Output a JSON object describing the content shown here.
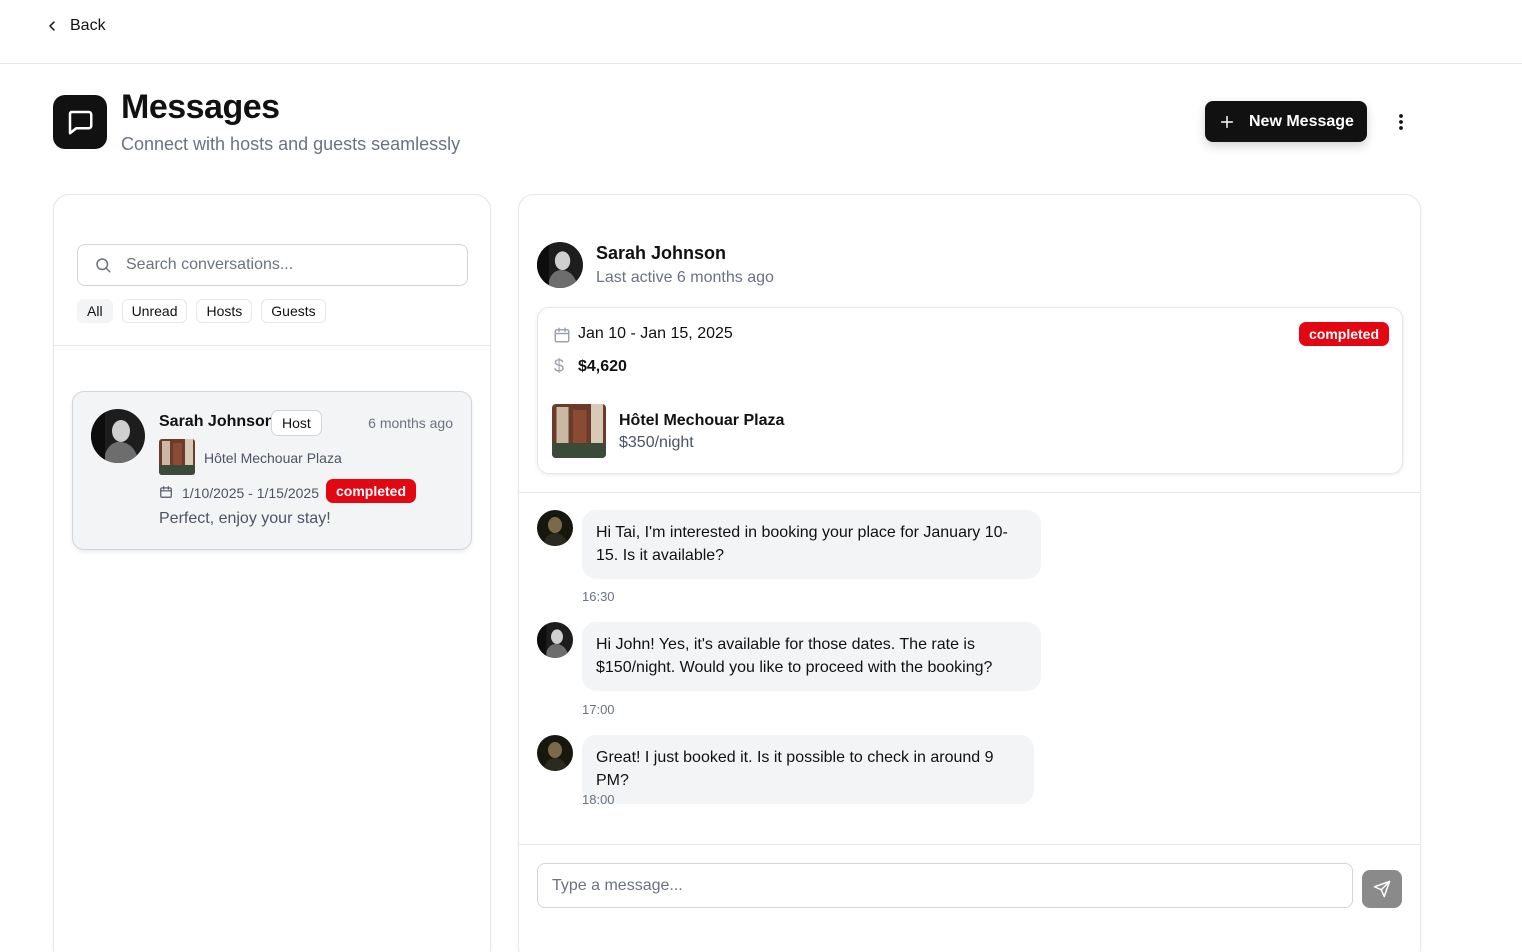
{
  "nav": {
    "back_label": "Back"
  },
  "header": {
    "title": "Messages",
    "subtitle": "Connect with hosts and guests seamlessly",
    "new_message_label": "New Message",
    "icons": {
      "header": "chat-bubble-icon",
      "new": "plus-icon",
      "more": "more-vertical-icon"
    }
  },
  "sidebar": {
    "search_placeholder": "Search conversations...",
    "filters": [
      "All",
      "Unread",
      "Hosts",
      "Guests"
    ],
    "active_filter": "All",
    "conversations": [
      {
        "name": "Sarah Johnson",
        "role": "Host",
        "time": "6 months ago",
        "hotel": "Hôtel Mechouar Plaza",
        "dates": "1/10/2025 - 1/15/2025",
        "status": "completed",
        "preview": "Perfect, enjoy your stay!"
      }
    ]
  },
  "chat": {
    "name": "Sarah Johnson",
    "last_active": "Last active 6 months ago",
    "booking": {
      "dates": "Jan 10 - Jan 15, 2025",
      "status": "completed",
      "currency_symbol": "$",
      "total": "$4,620",
      "hotel": "Hôtel Mechouar Plaza",
      "rate": "$350/night"
    },
    "messages": [
      {
        "text": "Hi Tai, I'm interested in booking your place for January 10-15. Is it available?",
        "time": "16:30"
      },
      {
        "text": "Hi John! Yes, it's available for those dates. The rate is $150/night. Would you like to proceed with the booking?",
        "time": "17:00"
      },
      {
        "text": "Great! I just booked it. Is it possible to check in around 9 PM?",
        "time": "18:00"
      }
    ],
    "composer_placeholder": "Type a message..."
  },
  "colors": {
    "primary": "#111111",
    "status_completed": "#e30613",
    "muted_text": "#6b7280",
    "bubble": "#f3f4f6",
    "send_disabled": "#8a8a8a"
  }
}
